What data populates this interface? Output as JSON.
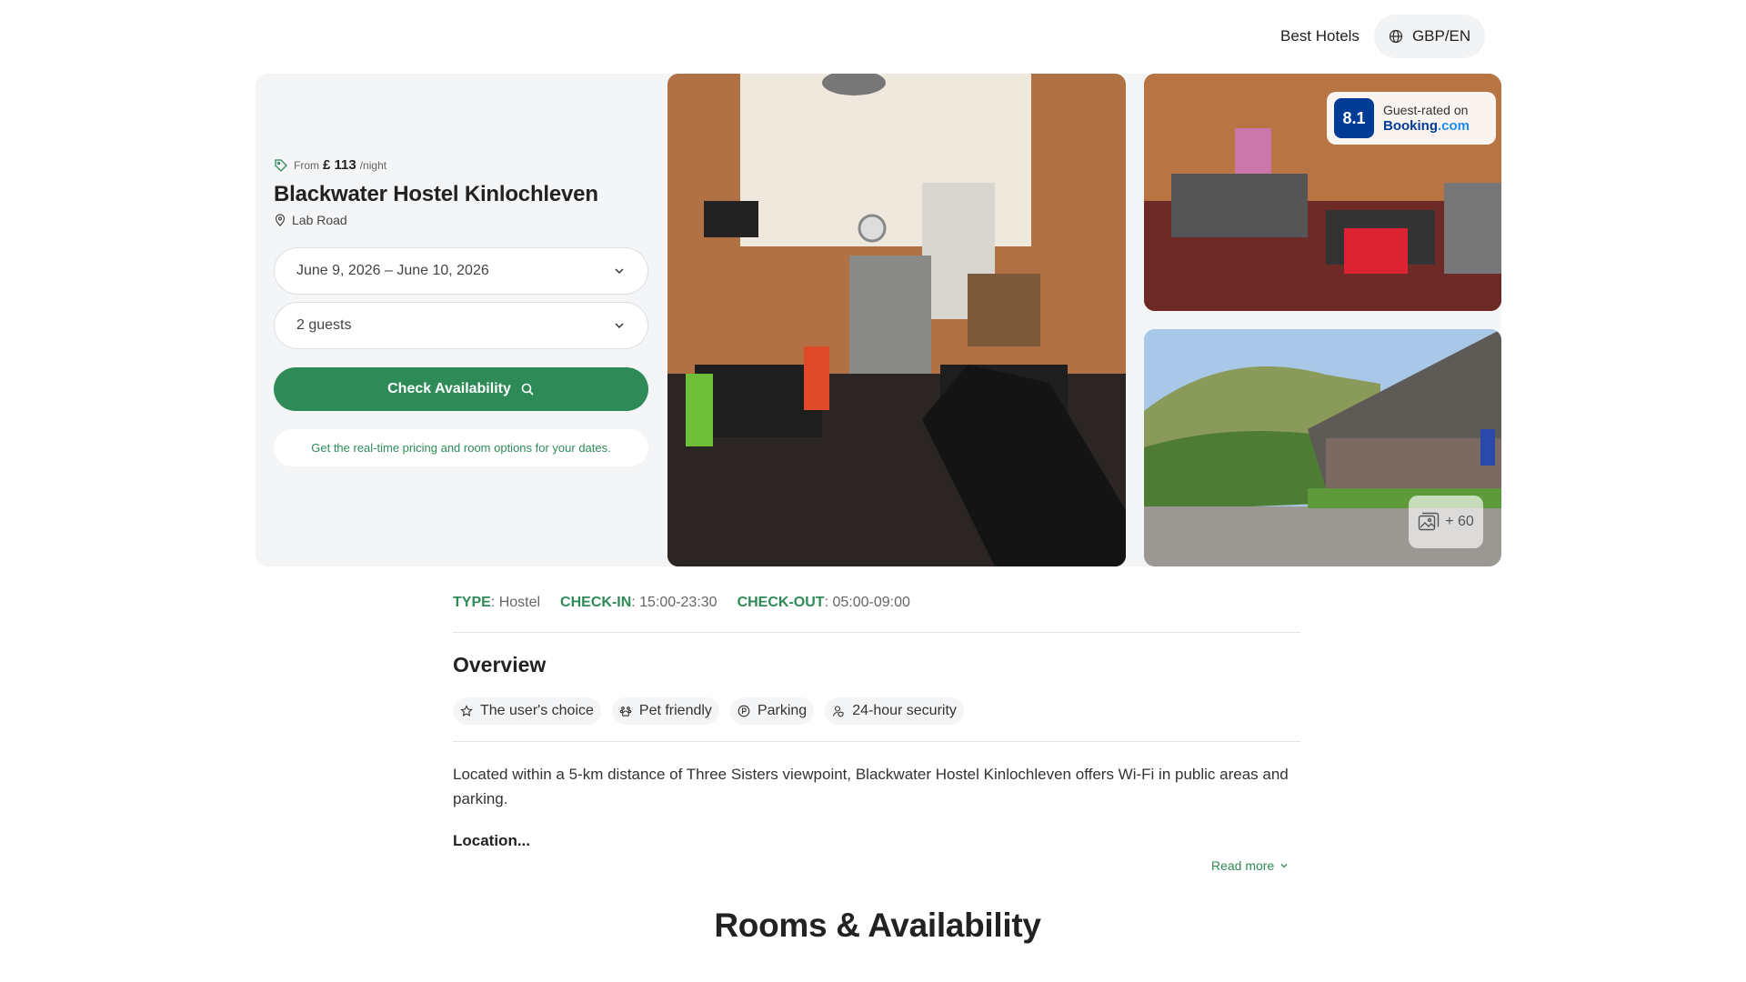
{
  "header": {
    "nav_link": "Best Hotels",
    "currency_label": "GBP/EN"
  },
  "booking": {
    "from_label": "From",
    "price": "£ 113",
    "per_night": "/night",
    "hotel_name": "Blackwater Hostel Kinlochleven",
    "address": "Lab Road",
    "dates_value": "June 9, 2026 – June 10, 2026",
    "guests_value": "2 guests",
    "check_button": "Check Availability",
    "hint": "Get the real-time pricing and room options for your dates."
  },
  "gallery": {
    "rating_score": "8.1",
    "rating_label": "Guest-rated on",
    "rating_brand": "Booking",
    "rating_brand_suffix": ".com",
    "more_photos": "+ 60"
  },
  "details": {
    "type_key": "TYPE",
    "type_value": "Hostel",
    "checkin_key": "CHECK-IN",
    "checkin_value": "15:00-23:30",
    "checkout_key": "CHECK-OUT",
    "checkout_value": "05:00-09:00"
  },
  "overview": {
    "title": "Overview",
    "chips": [
      {
        "label": "The user's choice",
        "icon": "star-icon"
      },
      {
        "label": "Pet friendly",
        "icon": "paw-icon"
      },
      {
        "label": "Parking",
        "icon": "parking-icon"
      },
      {
        "label": "24-hour security",
        "icon": "security-icon"
      }
    ],
    "description": "Located within a 5-km distance of Three Sisters viewpoint, Blackwater Hostel Kinlochleven offers Wi-Fi in public areas and parking.",
    "location_heading": "Location...",
    "read_more": "Read more"
  },
  "rooms": {
    "title": "Rooms & Availability"
  },
  "colors": {
    "accent": "#2e8b57",
    "booking_blue": "#003b95"
  }
}
